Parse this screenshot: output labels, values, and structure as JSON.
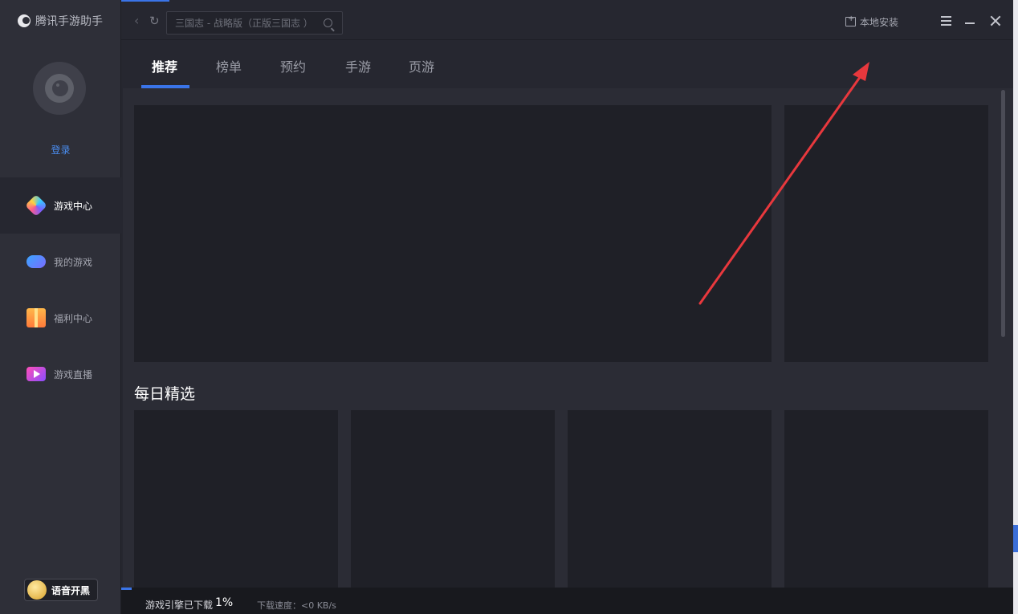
{
  "app": {
    "title": "腾讯手游助手"
  },
  "sidebar": {
    "login_label": "登录",
    "items": [
      {
        "label": "游戏中心",
        "icon": "game-center-icon",
        "active": true
      },
      {
        "label": "我的游戏",
        "icon": "gamepad-icon",
        "active": false
      },
      {
        "label": "福利中心",
        "icon": "gift-icon",
        "active": false
      },
      {
        "label": "游戏直播",
        "icon": "live-video-icon",
        "active": false
      }
    ],
    "voice_button": "语音开黑"
  },
  "topbar": {
    "search_placeholder": "三国志 - 战略版（正版三国志 ）",
    "local_install": "本地安装"
  },
  "tabs": [
    {
      "label": "推荐",
      "active": true
    },
    {
      "label": "榜单",
      "active": false
    },
    {
      "label": "预约",
      "active": false
    },
    {
      "label": "手游",
      "active": false
    },
    {
      "label": "页游",
      "active": false
    }
  ],
  "content": {
    "daily_picks_title": "每日精选"
  },
  "status": {
    "download_label": "游戏引擎已下载",
    "download_percent": "1%",
    "download_progress": 0.01,
    "speed": "下载速度：<0 KB/s"
  },
  "colors": {
    "accent": "#3a74e8",
    "login_link": "#4a8df0",
    "arrow": "#e8383d"
  }
}
